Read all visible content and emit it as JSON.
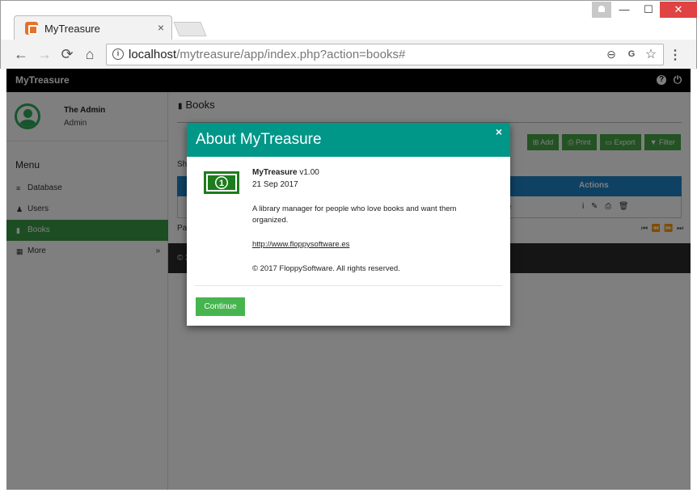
{
  "browser": {
    "tab_title": "MyTreasure",
    "tab_close": "×",
    "url_host": "localhost",
    "url_path": "/mytreasure/app/index.php?action=books#",
    "back": "←",
    "forward": "→",
    "reload": "⟳",
    "home": "⌂",
    "info": "i",
    "zoom": "⊖",
    "translate": "G",
    "star": "☆",
    "menu": "⋮",
    "win_min": "—",
    "win_max": "☐",
    "win_close": "✕"
  },
  "navbar": {
    "brand": "MyTreasure",
    "help": "?",
    "power": "⏻"
  },
  "sidebar": {
    "user_name": "The Admin",
    "user_role": "Admin",
    "menu_title": "Menu",
    "items": [
      {
        "icon": "≡",
        "label": "Database",
        "arrow": ""
      },
      {
        "icon": "♟",
        "label": "Users",
        "arrow": ""
      },
      {
        "icon": "▮",
        "label": "Books",
        "arrow": ""
      },
      {
        "icon": "▦",
        "label": "More",
        "arrow": "»"
      }
    ]
  },
  "content": {
    "title_icon": "▮",
    "title": "Books",
    "buttons": [
      {
        "icon": "⊞",
        "label": "Add"
      },
      {
        "icon": "⎙",
        "label": "Print"
      },
      {
        "icon": "▭",
        "label": "Export"
      },
      {
        "icon": "▼",
        "label": "Filter"
      }
    ],
    "show_label": "Sh",
    "actions_header": "Actions",
    "row_text": "ure",
    "row_actions": "i ✎ ⎙ 🗑",
    "pagination_label": "Pa",
    "pager": "⏮ ⏪ ⏩ ⏭",
    "footer_text": "© 2"
  },
  "modal": {
    "title": "About MyTreasure",
    "close": "×",
    "app_name": "MyTreasure",
    "app_version": " v1.00",
    "app_date": "21 Sep 2017",
    "description": "A library manager for people who love books and want them organized.",
    "link": "http://www.floppysoftware.es",
    "copyright": "© 2017 FloppySoftware. All rights reserved.",
    "continue_label": "Continue",
    "money_digit": "1"
  }
}
